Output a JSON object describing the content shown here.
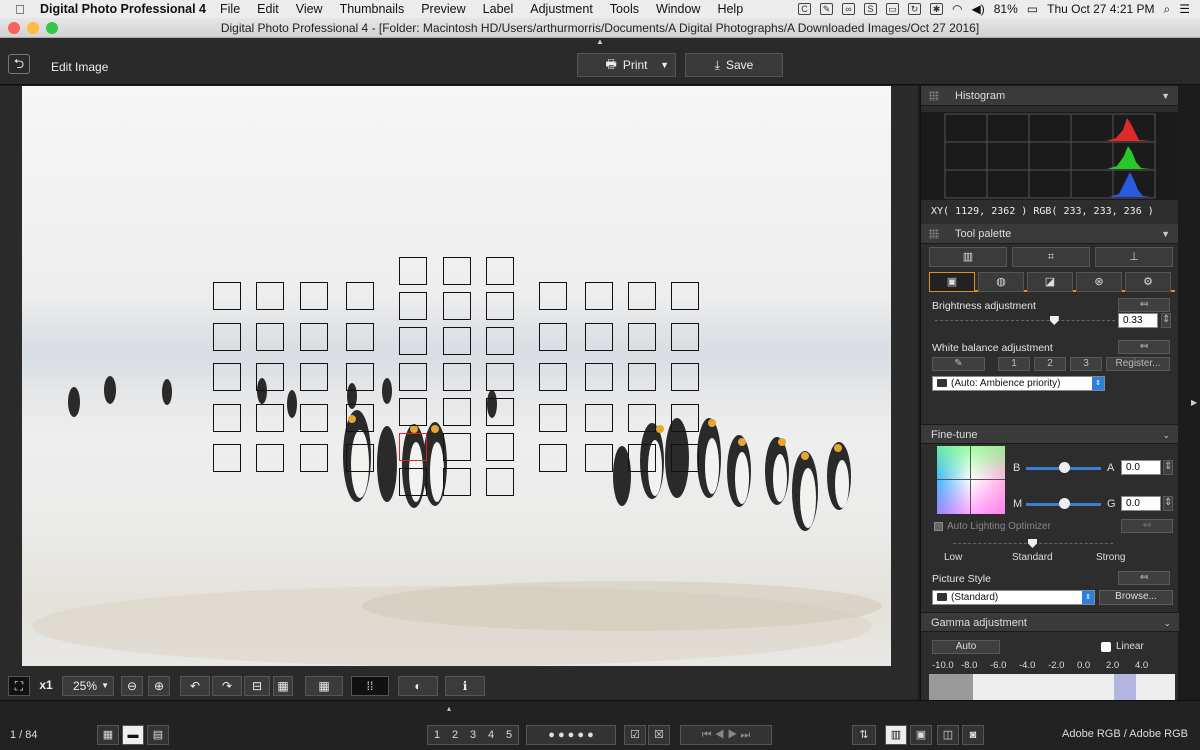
{
  "menubar": {
    "app_name": "Digital Photo Professional 4",
    "items": [
      "File",
      "Edit",
      "View",
      "Thumbnails",
      "Preview",
      "Label",
      "Adjustment",
      "Tools",
      "Window",
      "Help"
    ],
    "battery": "81%",
    "clock": "Thu Oct 27  4:21 PM"
  },
  "window": {
    "title": "Digital Photo Professional 4 - [Folder: Macintosh HD/Users/arthurmorris/Documents/A Digital Photographs/A Downloaded Images/Oct 27 2016]"
  },
  "toolbar": {
    "edit_label": "Edit Image",
    "print_label": "Print",
    "save_label": "Save"
  },
  "viewer_controls": {
    "magnify_label": "x1",
    "zoom_value": "25%"
  },
  "status": {
    "page_count": "1 / 84",
    "color_space": "Adobe RGB / Adobe RGB",
    "rating_labels": [
      "1",
      "2",
      "3",
      "4",
      "5"
    ]
  },
  "histogram": {
    "header": "Histogram",
    "readout": "XY(  1129,  2362 ) RGB( 233, 233, 236 )"
  },
  "tool_palette": {
    "header": "Tool palette",
    "brightness_label": "Brightness adjustment",
    "brightness_value": "0.33",
    "brightness_level": 0.66,
    "wb_label": "White balance adjustment",
    "wb_presets": [
      "1",
      "2",
      "3"
    ],
    "register_label": "Register...",
    "wb_value": "(Auto: Ambience priority)"
  },
  "fine_tune": {
    "header": "Fine-tune",
    "b_label": "B",
    "a_label": "A",
    "a_value": "0.0",
    "m_label": "M",
    "g_label": "G",
    "g_value": "0.0",
    "alo_label": "Auto Lighting Optimizer",
    "alo_levels": [
      "Low",
      "Standard",
      "Strong"
    ],
    "picture_style_label": "Picture Style",
    "picture_style_value": "(Standard)",
    "browse_label": "Browse..."
  },
  "gamma": {
    "header": "Gamma adjustment",
    "auto_label": "Auto",
    "linear_label": "Linear",
    "scale": [
      "-10.0",
      "-8.0",
      "-6.0",
      "-4.0",
      "-2.0",
      "0.0",
      "2.0",
      "4.0"
    ]
  },
  "colors": {
    "accent": "#2d7fd8",
    "af_active": "#dd2222"
  }
}
